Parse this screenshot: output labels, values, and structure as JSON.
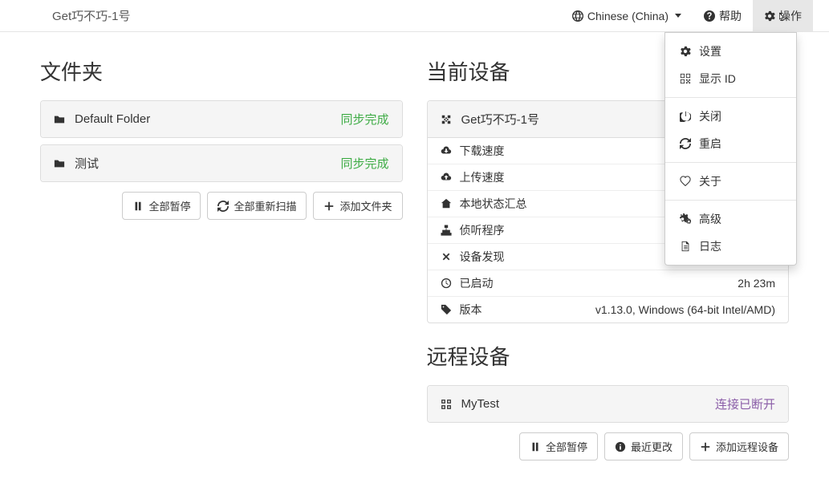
{
  "navbar": {
    "brand": "Get巧不巧-1号",
    "language": "Chinese (China)",
    "help": "帮助",
    "actions": "操作"
  },
  "dropdown": {
    "settings": "设置",
    "show_id": "显示 ID",
    "shutdown": "关闭",
    "restart": "重启",
    "about": "关于",
    "advanced": "高级",
    "logs": "日志"
  },
  "folders": {
    "title": "文件夹",
    "items": [
      {
        "name": "Default Folder",
        "status": "同步完成"
      },
      {
        "name": "测试",
        "status": "同步完成"
      }
    ],
    "buttons": {
      "pause_all": "全部暂停",
      "rescan_all": "全部重新扫描",
      "add_folder": "添加文件夹"
    }
  },
  "this_device": {
    "title": "当前设备",
    "name": "Get巧不巧-1号",
    "stats": {
      "download": "下载速度",
      "upload": "上传速度",
      "local_state": "本地状态汇总",
      "listeners": "侦听程序",
      "discovery": "设备发现",
      "uptime_label": "已启动",
      "uptime_value": "2h 23m",
      "version_label": "版本",
      "version_value": "v1.13.0, Windows (64-bit Intel/AMD)"
    }
  },
  "remote_devices": {
    "title": "远程设备",
    "items": [
      {
        "name": "MyTest",
        "status": "连接已断开"
      }
    ],
    "buttons": {
      "pause_all": "全部暂停",
      "recent_changes": "最近更改",
      "add_device": "添加远程设备"
    }
  }
}
